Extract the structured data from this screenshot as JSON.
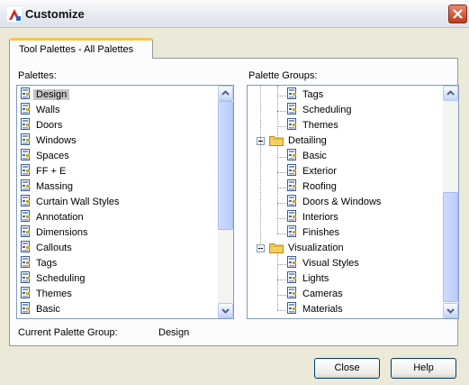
{
  "window": {
    "title": "Customize"
  },
  "tabs": [
    {
      "label": "Tool Palettes - All Palettes"
    }
  ],
  "palettes": {
    "label": "Palettes:",
    "items": [
      "Design",
      "Walls",
      "Doors",
      "Windows",
      "Spaces",
      "FF + E",
      "Massing",
      "Curtain Wall Styles",
      "Annotation",
      "Dimensions",
      "Callouts",
      "Tags",
      "Scheduling",
      "Themes",
      "Basic"
    ],
    "selected": "Design"
  },
  "groups": {
    "label": "Palette Groups:",
    "rows": [
      {
        "text": "Tags",
        "kind": "palette"
      },
      {
        "text": "Scheduling",
        "kind": "palette"
      },
      {
        "text": "Themes",
        "kind": "palette"
      },
      {
        "text": "Detailing",
        "kind": "group"
      },
      {
        "text": "Basic",
        "kind": "palette"
      },
      {
        "text": "Exterior",
        "kind": "palette"
      },
      {
        "text": "Roofing",
        "kind": "palette"
      },
      {
        "text": "Doors & Windows",
        "kind": "palette"
      },
      {
        "text": "Interiors",
        "kind": "palette"
      },
      {
        "text": "Finishes",
        "kind": "palette"
      },
      {
        "text": "Visualization",
        "kind": "group"
      },
      {
        "text": "Visual Styles",
        "kind": "palette"
      },
      {
        "text": "Lights",
        "kind": "palette"
      },
      {
        "text": "Cameras",
        "kind": "palette"
      },
      {
        "text": "Materials",
        "kind": "palette"
      }
    ]
  },
  "current_group": {
    "label": "Current Palette Group:",
    "value": "Design"
  },
  "buttons": {
    "close": "Close",
    "help": "Help"
  }
}
